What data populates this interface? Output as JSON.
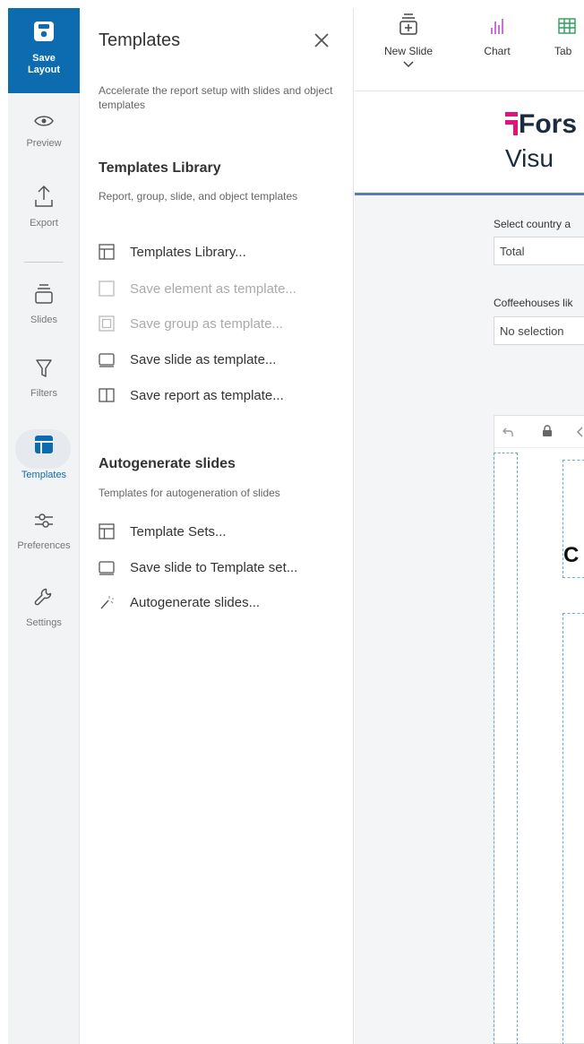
{
  "rail": {
    "save_label_1": "Save",
    "save_label_2": "Layout",
    "items": [
      {
        "label": "Preview",
        "icon": "eye-icon"
      },
      {
        "label": "Export",
        "icon": "export-icon"
      },
      {
        "label": "Slides",
        "icon": "slides-icon"
      },
      {
        "label": "Filters",
        "icon": "filter-icon"
      },
      {
        "label": "Templates",
        "icon": "templates-icon"
      },
      {
        "label": "Preferences",
        "icon": "sliders-icon"
      },
      {
        "label": "Settings",
        "icon": "wrench-icon"
      }
    ]
  },
  "panel": {
    "title": "Templates",
    "description": "Accelerate the report setup with slides and object templates",
    "library": {
      "title": "Templates Library",
      "description": "Report, group, slide, and object templates",
      "items": [
        {
          "label": "Templates Library...",
          "enabled": true
        },
        {
          "label": "Save element as template...",
          "enabled": false
        },
        {
          "label": "Save group as template...",
          "enabled": false
        },
        {
          "label": "Save slide as template...",
          "enabled": true
        },
        {
          "label": "Save report as template...",
          "enabled": true
        }
      ]
    },
    "autogen": {
      "title": "Autogenerate slides",
      "description": "Templates for autogeneration of slides",
      "items": [
        {
          "label": "Template Sets..."
        },
        {
          "label": "Save slide to Template set..."
        },
        {
          "label": "Autogenerate slides..."
        }
      ]
    }
  },
  "toolbar": {
    "new_slide": "New Slide",
    "chart": "Chart",
    "table": "Tab"
  },
  "report": {
    "logo_text": "Fors",
    "logo_sub": "Visu",
    "filter1_label": "Select country a",
    "filter1_value": "Total",
    "filter2_label": "Coffeehouses lik",
    "filter2_value": "No selection",
    "slide_text": "C"
  },
  "colors": {
    "accent": "#0d6cb0",
    "brand_magenta": "#e0137a",
    "header_rule": "#5b7bb5"
  }
}
